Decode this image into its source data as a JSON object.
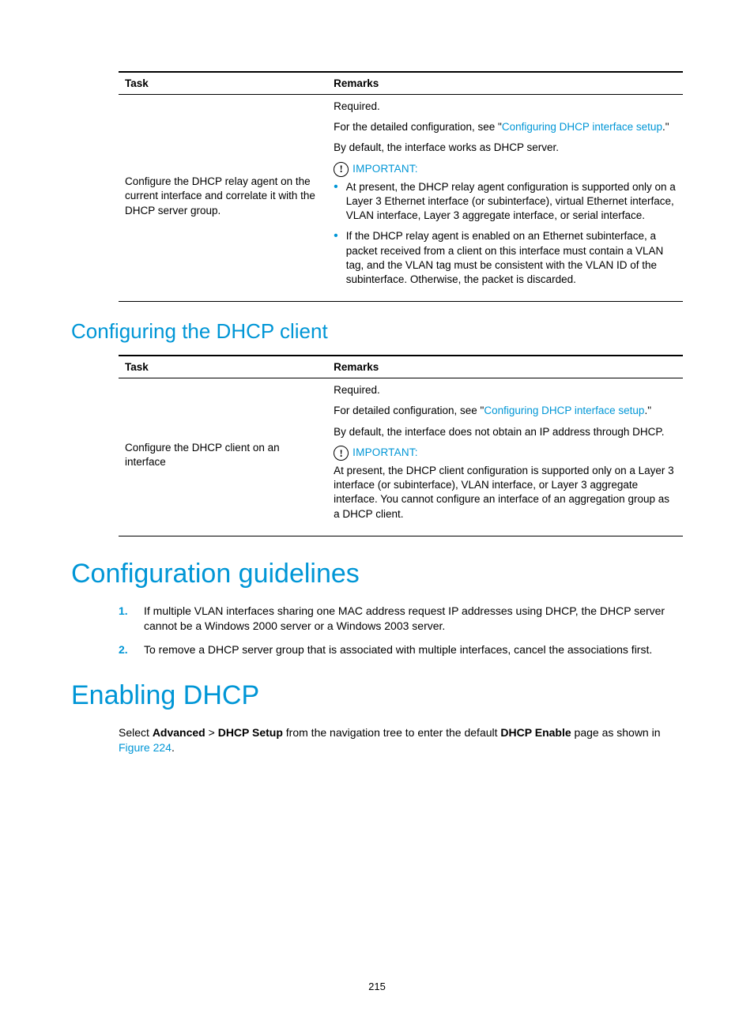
{
  "table1": {
    "headers": {
      "task": "Task",
      "remarks": "Remarks"
    },
    "row": {
      "task": "Configure the DHCP relay agent on the current interface and correlate it with the DHCP server group.",
      "remarks": {
        "required": "Required.",
        "detail_prefix": "For the detailed configuration, see \"",
        "detail_link": "Configuring DHCP interface setup",
        "detail_suffix": ".\"",
        "default": "By default, the interface works as DHCP server.",
        "important_label": "IMPORTANT:",
        "bullet1": "At present, the DHCP relay agent configuration is supported only on a Layer 3 Ethernet interface (or subinterface), virtual Ethernet interface, VLAN interface, Layer 3 aggregate interface, or serial interface.",
        "bullet2": "If the DHCP relay agent is enabled on an Ethernet subinterface, a packet received from a client on this interface must contain a VLAN tag, and the VLAN tag must be consistent with the VLAN ID of the subinterface. Otherwise, the packet is discarded."
      }
    }
  },
  "section_dhcp_client": "Configuring the DHCP client",
  "table2": {
    "headers": {
      "task": "Task",
      "remarks": "Remarks"
    },
    "row": {
      "task": "Configure the DHCP client on an interface",
      "remarks": {
        "required": "Required.",
        "detail_prefix": "For detailed configuration, see \"",
        "detail_link": "Configuring DHCP interface setup",
        "detail_suffix": ".\"",
        "default": "By default, the interface does not obtain an IP address through DHCP.",
        "important_label": "IMPORTANT:",
        "note": "At present, the DHCP client configuration is supported only on a Layer 3 interface (or subinterface), VLAN interface, or Layer 3 aggregate interface. You cannot configure an interface of an aggregation group as a DHCP client."
      }
    }
  },
  "section_guidelines": "Configuration guidelines",
  "guidelines": {
    "g1": "If multiple VLAN interfaces sharing one MAC address request IP addresses using DHCP, the DHCP server cannot be a Windows 2000 server or a Windows 2003 server.",
    "g2": "To remove a DHCP server group that is associated with multiple interfaces, cancel the associations first."
  },
  "section_enable": "Enabling DHCP",
  "enable_para": {
    "p1a": "Select ",
    "p1b": "Advanced",
    "p1c": " > ",
    "p1d": "DHCP Setup",
    "p1e": " from the navigation tree to enter the default ",
    "p1f": "DHCP Enable",
    "p1g": " page as shown in ",
    "fig_link": "Figure 224",
    "p1h": "."
  },
  "page_number": "215",
  "icon_glyph": "!"
}
